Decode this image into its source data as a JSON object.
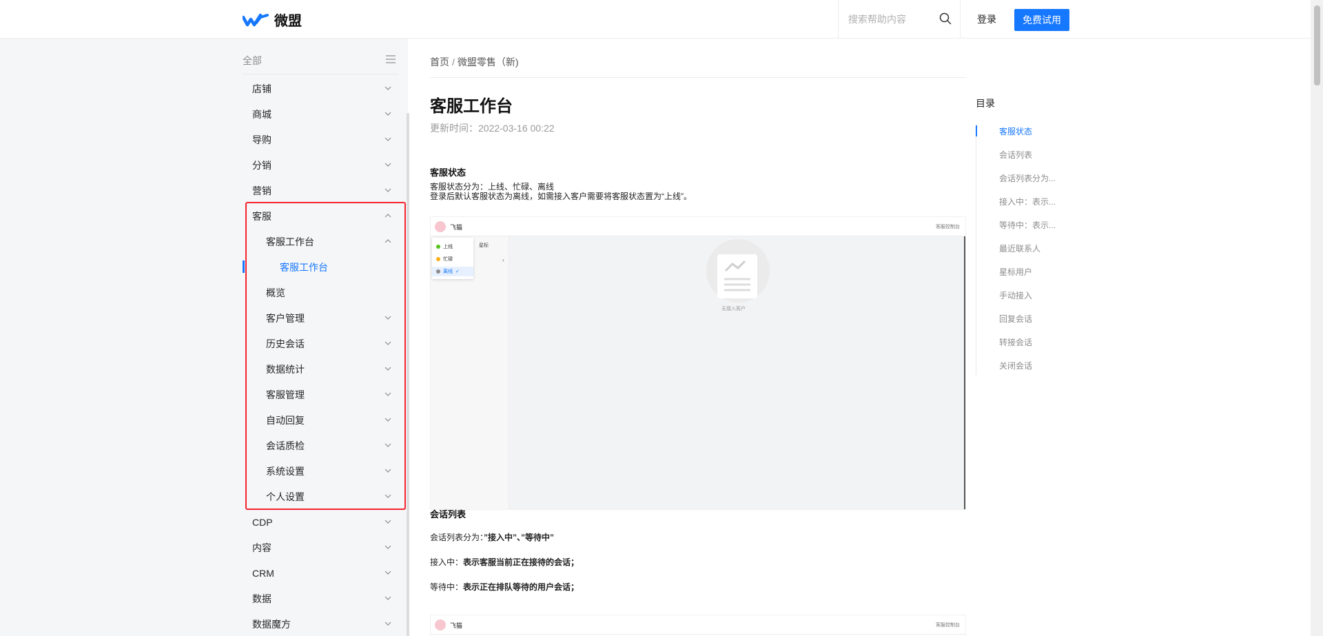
{
  "header": {
    "logo_text": "微盟",
    "search_placeholder": "搜索帮助内容",
    "login_label": "登录",
    "trial_label": "免费试用",
    "accent": "#1677ff"
  },
  "sidebar": {
    "head_label": "全部",
    "items": [
      {
        "label": "店铺",
        "level": 1,
        "chevron": "down"
      },
      {
        "label": "商城",
        "level": 1,
        "chevron": "down"
      },
      {
        "label": "导购",
        "level": 1,
        "chevron": "down"
      },
      {
        "label": "分销",
        "level": 1,
        "chevron": "down"
      },
      {
        "label": "营销",
        "level": 1,
        "chevron": "down"
      },
      {
        "label": "客服",
        "level": 1,
        "chevron": "up"
      },
      {
        "label": "客服工作台",
        "level": 2,
        "chevron": "up"
      },
      {
        "label": "客服工作台",
        "level": 3,
        "chevron": "none",
        "active": true
      },
      {
        "label": "概览",
        "level": 2,
        "chevron": "none"
      },
      {
        "label": "客户管理",
        "level": 2,
        "chevron": "down"
      },
      {
        "label": "历史会话",
        "level": 2,
        "chevron": "down"
      },
      {
        "label": "数据统计",
        "level": 2,
        "chevron": "down"
      },
      {
        "label": "客服管理",
        "level": 2,
        "chevron": "down"
      },
      {
        "label": "自动回复",
        "level": 2,
        "chevron": "down"
      },
      {
        "label": "会话质检",
        "level": 2,
        "chevron": "down"
      },
      {
        "label": "系统设置",
        "level": 2,
        "chevron": "down"
      },
      {
        "label": "个人设置",
        "level": 2,
        "chevron": "down"
      },
      {
        "label": "CDP",
        "level": 1,
        "chevron": "down"
      },
      {
        "label": "内容",
        "level": 1,
        "chevron": "down"
      },
      {
        "label": "CRM",
        "level": 1,
        "chevron": "down"
      },
      {
        "label": "数据",
        "level": 1,
        "chevron": "down"
      },
      {
        "label": "数据魔方",
        "level": 1,
        "chevron": "down"
      }
    ],
    "highlight_color": "#f5222d"
  },
  "content": {
    "breadcrumb_home": "首页",
    "breadcrumb_sep": "/",
    "breadcrumb_current": "微盟零售（新)",
    "title": "客服工作台",
    "updated": "更新时间：2022-03-16 00:22",
    "section1_title": "客服状态",
    "section1_line1": "客服状态分为：上线、忙碌、离线",
    "section1_line2": "登录后默认客服状态为离线，如需接入客户需要将客服状态置为“上线”。",
    "shot1": {
      "user_name": "飞猫",
      "right_label": "客服控制台",
      "status_online": "上线",
      "status_busy": "忙碌",
      "status_offline": "离线",
      "submenu": "星标",
      "empty_text": "无接入客户",
      "colors": {
        "online": "#52c41a",
        "busy": "#faad14",
        "offline": "#8c8c8c"
      }
    },
    "section2_title": "会话列表",
    "section2_line1_prefix": "会话列表分为：",
    "section2_line1_bold": "”接入中”、”等待中”",
    "section2_line2_prefix": "接入中：",
    "section2_line2_bold": "表示客服当前正在接待的会话；",
    "section2_line3_prefix": "等待中：",
    "section2_line3_bold": "表示正在排队等待的用户会话；",
    "shot2": {
      "user_name": "飞猫",
      "right_label": "客服控制台"
    }
  },
  "toc": {
    "title": "目录",
    "items": [
      {
        "label": "客服状态",
        "active": true
      },
      {
        "label": "会话列表",
        "active": false
      },
      {
        "label": "会话列表分为...",
        "active": false
      },
      {
        "label": "接入中：表示...",
        "active": false
      },
      {
        "label": "等待中：表示...",
        "active": false
      },
      {
        "label": "最近联系人",
        "active": false
      },
      {
        "label": "星标用户",
        "active": false
      },
      {
        "label": "手动接入",
        "active": false
      },
      {
        "label": "回复会话",
        "active": false
      },
      {
        "label": "转接会话",
        "active": false
      },
      {
        "label": "关闭会话",
        "active": false
      }
    ]
  }
}
